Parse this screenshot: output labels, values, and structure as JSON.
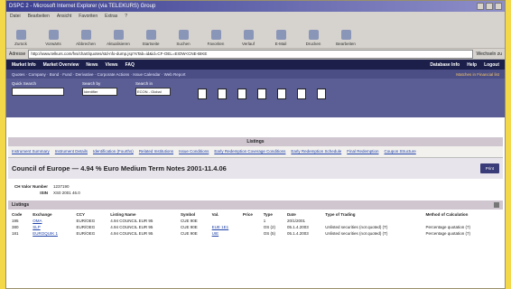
{
  "window": {
    "title": "DSPC 2 - Microsoft Internet Explorer (via TELEKURS) Group"
  },
  "menubar": {
    "items": [
      "Datei",
      "Bearbeiten",
      "Ansicht",
      "Favoriten",
      "Extras",
      "?"
    ]
  },
  "toolbar": {
    "items": [
      "Zurück",
      "Vorwärts",
      "Abbrechen",
      "Aktualisieren",
      "Startseite",
      "Suchen",
      "Favoriten",
      "Verlauf",
      "E-Mail",
      "Drucken",
      "Bearbeiten"
    ]
  },
  "address": {
    "label": "Adresse",
    "url": "http://www.telkurs.com/fvs/chart/quotes/std-nfo-dump.jsp?sTab=id&id=CF-OEL=EIOW<CNE-BIKE",
    "go": "Wechseln zu"
  },
  "nav1": {
    "left": [
      "Market Info",
      "Market Overview",
      "News",
      "Views",
      "FAQ"
    ],
    "right": [
      "Database Info",
      "Help",
      "Logout"
    ]
  },
  "nav2": {
    "left": "Quotes · Company · Bond · Fund · Derivative · Corporate Actions · Issue Calendar · Web Report",
    "right": "Matches in Financial list"
  },
  "search": {
    "label1": "Quick Search",
    "label2": "Search by",
    "label3": "Search in",
    "sel2": "Identifier",
    "sel3": "ECON - Global"
  },
  "listing": {
    "title": "Listings"
  },
  "links": [
    "Instrument Summary",
    "Instrument Details",
    "Identification (Fourths)",
    "Related Institutions",
    "Issue Conditions",
    "Early Redemption Coverage Conditions",
    "Early Redemption Schedule",
    "Final Redemption",
    "Coupon Structure"
  ],
  "entity": {
    "name": "Council of Europe — 4.94 % Euro Medium Term Notes 2001-11.4.06",
    "button": "Print"
  },
  "meta": [
    {
      "k": "CH Valor Number",
      "v": "1237190"
    },
    {
      "k": "ISIN",
      "v": "XS0 2001 46.0"
    }
  ],
  "listings": {
    "title": "Listings",
    "headers": [
      "Code",
      "Exchange",
      "CCY",
      "Listing Name",
      "Symbol",
      "Val.",
      "Price",
      "Type",
      "Date",
      "Type of Trading",
      "Method of Calculation"
    ],
    "rows": [
      [
        "195",
        "OMA",
        "EUR/OEG",
        "4.94 COUNCIL EUR 95",
        "CUE 90E",
        "",
        "",
        "1",
        "20/1/2001",
        "",
        ""
      ],
      [
        "380",
        "SLP",
        "EUR/OEG",
        "4.94 COUNCIL EUR 95",
        "CUE 90E",
        "EUE 1E1",
        "",
        "OS (2)",
        "05.1.4.2003",
        "Unlisted securities (not quoted) (T)",
        "Percentage quotation (7)"
      ],
      [
        "181",
        "EUROQUIK 1",
        "EUR/OEG",
        "4.94 COUNCIL EUR 95",
        "CUE 90E",
        "UIE",
        "",
        "OS (5)",
        "05.1.4.2003",
        "Unlisted securities (not quoted) (T)",
        "Percentage quotation (7)"
      ]
    ]
  }
}
